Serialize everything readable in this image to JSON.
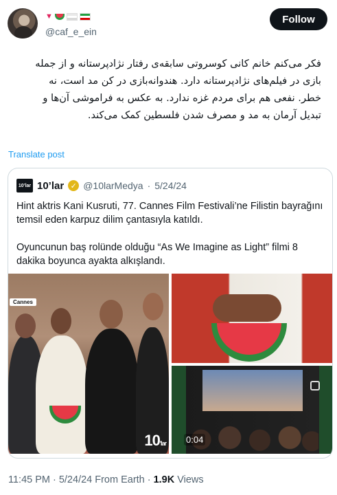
{
  "author": {
    "handle": "@caf_e_ein",
    "follow_label": "Follow"
  },
  "tweet": {
    "lines": [
      "فکر می‌کنم خانم کانی کوسروتی سابقه‌ی رفتار نژادپرستانه و از جمله",
      "بازی در فیلم‌های نژادپرستانه دارد. هندوانه‌بازی در کن مد است، نه",
      "خطر. نفعی هم برای مردم غزه ندارد. به عکس به فراموشی آن‌ها و",
      "تبدیل آرمان به مد و مصرف شدن فلسطین کمک می‌کند."
    ],
    "translate_label": "Translate post"
  },
  "quote": {
    "logo_text": "10’lar",
    "name": "10’lar",
    "handle": "@10larMedya",
    "separator": "·",
    "date": "5/24/24",
    "paragraph1": "Hint aktris Kani Kusruti, 77. Cannes Film Festivali’ne Filistin bayrağını temsil eden karpuz dilim çantasıyla katıldı.",
    "paragraph2": "Oyuncunun baş rolünde olduğu “As We Imagine as Light” filmi 8 dakika boyunca ayakta alkışlandı.",
    "media": {
      "badge": "Cannes",
      "watermark": "10",
      "watermark_suffix": "'lar",
      "video_duration": "0:04"
    }
  },
  "footer": {
    "time": "11:45 PM",
    "dot1": "·",
    "date": "5/24/24",
    "source": "From Earth",
    "dot2": "·",
    "views_count": "1.9K",
    "views_label": "Views"
  },
  "colors": {
    "link": "#1d9bf0",
    "muted": "#536471",
    "verified": "#e2b719"
  }
}
